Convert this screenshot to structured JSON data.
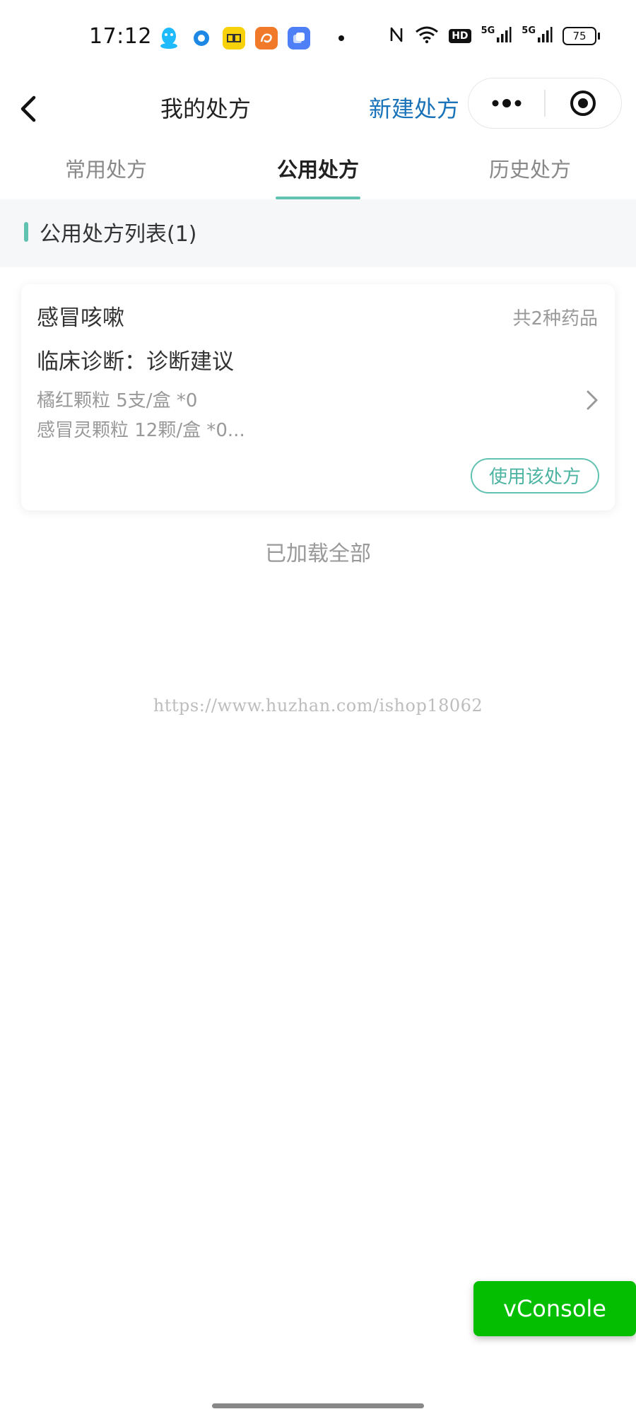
{
  "status_bar": {
    "time": "17:12",
    "app_icons": [
      "qq-icon",
      "circle-app-icon",
      "yellow-app-icon",
      "uc-browser-icon",
      "blue-app-icon"
    ],
    "hd_label": "HD",
    "network_1": "5G",
    "network_2": "5G",
    "battery": "75"
  },
  "nav": {
    "title": "我的处方",
    "new_label": "新建处方"
  },
  "tabs": [
    {
      "label": "常用处方",
      "active": false
    },
    {
      "label": "公用处方",
      "active": true
    },
    {
      "label": "历史处方",
      "active": false
    }
  ],
  "section": {
    "title": "公用处方列表(1)"
  },
  "cards": [
    {
      "name": "感冒咳嗽",
      "count": "共2种药品",
      "diagnosis": "临床诊断：诊断建议",
      "drugs": [
        "橘红颗粒 5支/盒 *0",
        "感冒灵颗粒 12颗/盒 *0..."
      ],
      "use_label": "使用该处方"
    }
  ],
  "footer": {
    "loaded_all": "已加载全部",
    "watermark": "https://www.huzhan.com/ishop18062"
  },
  "vconsole": {
    "label": "vConsole"
  },
  "colors": {
    "accent": "#62c2b2",
    "link": "#1a73b8",
    "vconsole": "#04be02"
  }
}
